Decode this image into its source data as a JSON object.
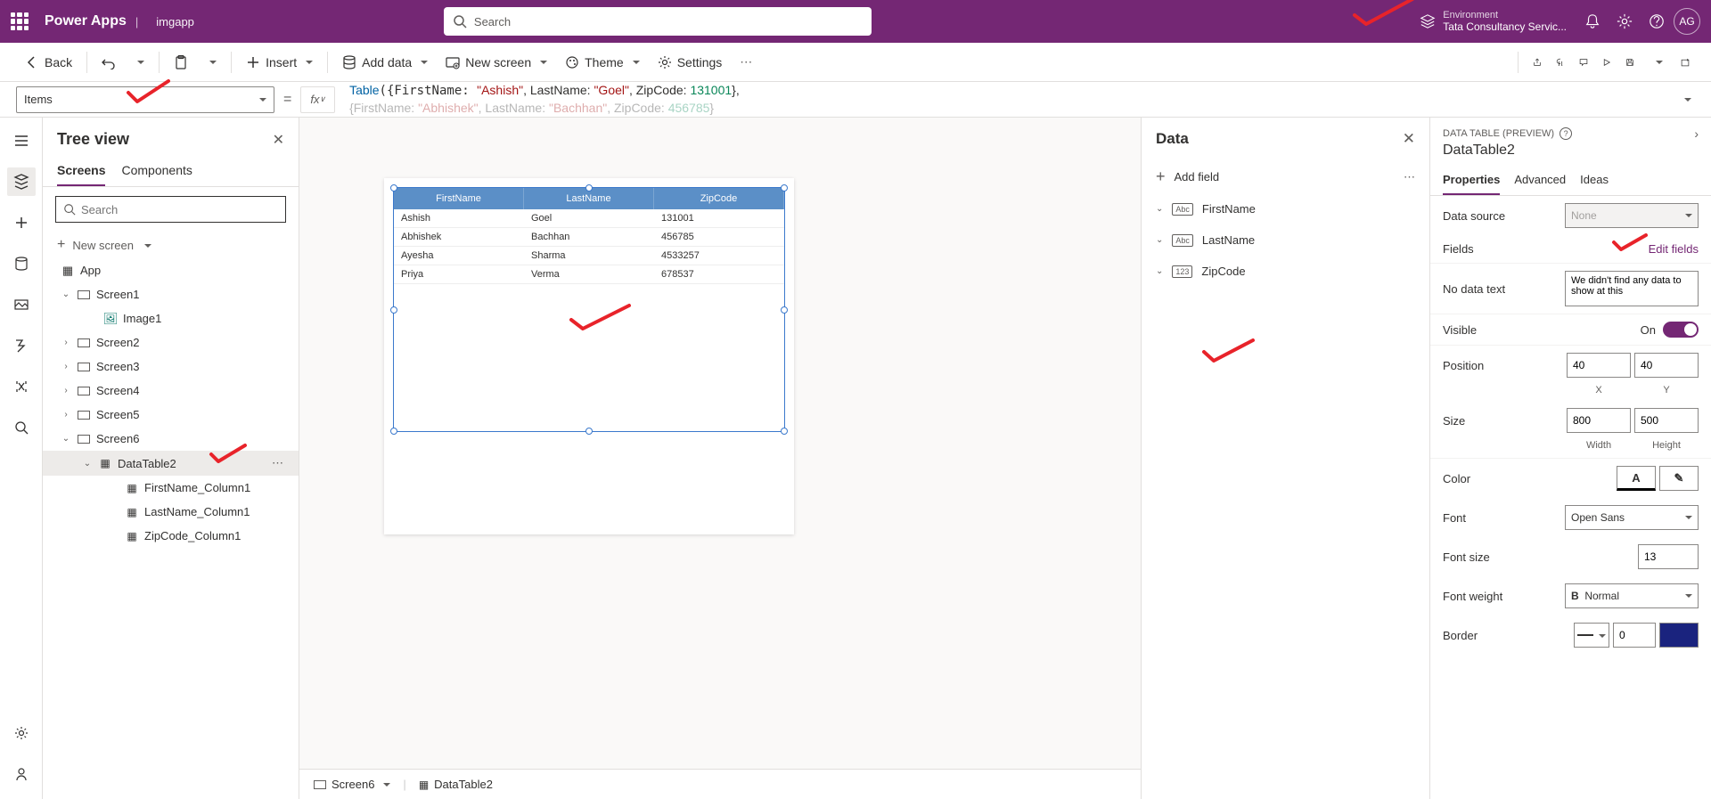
{
  "header": {
    "appTitle": "Power Apps",
    "separator": "|",
    "appName": "imgapp",
    "searchPlaceholder": "Search",
    "envLabel": "Environment",
    "envName": "Tata Consultancy Servic...",
    "avatar": "AG"
  },
  "cmd": {
    "back": "Back",
    "insert": "Insert",
    "addData": "Add data",
    "newScreen": "New screen",
    "theme": "Theme",
    "settings": "Settings"
  },
  "formula": {
    "propSelector": "Items",
    "eq": "=",
    "fx": "fx",
    "line1_pre": "Table({FirstName: ",
    "line1_s1": "\"Ashish\"",
    "line1_m1": ", LastName: ",
    "line1_s2": "\"Goel\"",
    "line1_m2": ", ZipCode: ",
    "line1_n1": "131001",
    "line1_post": "},",
    "line2_pre": "{FirstName: ",
    "line2_s1": "\"Abhishek\"",
    "line2_m1": ", LastName: ",
    "line2_s2": "\"Bachhan\"",
    "line2_m2": ", ZipCode: ",
    "line2_n1": "456785",
    "line2_post": "}"
  },
  "tree": {
    "title": "Tree view",
    "tabScreens": "Screens",
    "tabComponents": "Components",
    "searchPlaceholder": "Search",
    "newScreen": "New screen",
    "app": "App",
    "items": {
      "screen1": "Screen1",
      "image1": "Image1",
      "screen2": "Screen2",
      "screen3": "Screen3",
      "screen4": "Screen4",
      "screen5": "Screen5",
      "screen6": "Screen6",
      "dataTable2": "DataTable2",
      "col1": "FirstName_Column1",
      "col2": "LastName_Column1",
      "col3": "ZipCode_Column1"
    }
  },
  "table": {
    "headers": [
      "FirstName",
      "LastName",
      "ZipCode"
    ],
    "rows": [
      [
        "Ashish",
        "Goel",
        "131001"
      ],
      [
        "Abhishek",
        "Bachhan",
        "456785"
      ],
      [
        "Ayesha",
        "Sharma",
        "4533257"
      ],
      [
        "Priya",
        "Verma",
        "678537"
      ]
    ]
  },
  "dataPanel": {
    "title": "Data",
    "addField": "Add field",
    "fields": {
      "f1": "FirstName",
      "f2": "LastName",
      "f3": "ZipCode"
    },
    "abc": "Abc",
    "num": "123"
  },
  "props": {
    "type": "DATA TABLE (PREVIEW)",
    "name": "DataTable2",
    "tabProperties": "Properties",
    "tabAdvanced": "Advanced",
    "tabIdeas": "Ideas",
    "dataSource": "Data source",
    "dataSourceVal": "None",
    "fields": "Fields",
    "editFields": "Edit fields",
    "noDataText": "No data text",
    "noDataVal": "We didn't find any data to show at this",
    "visible": "Visible",
    "visibleOn": "On",
    "position": "Position",
    "posX": "40",
    "posY": "40",
    "xLabel": "X",
    "yLabel": "Y",
    "size": "Size",
    "width": "800",
    "height": "500",
    "wLabel": "Width",
    "hLabel": "Height",
    "color": "Color",
    "font": "Font",
    "fontVal": "Open Sans",
    "fontSize": "Font size",
    "fontSizeVal": "13",
    "fontWeight": "Font weight",
    "fontWeightVal": "Normal",
    "border": "Border",
    "borderVal": "0"
  },
  "breadcrumb": {
    "screen": "Screen6",
    "control": "DataTable2"
  }
}
